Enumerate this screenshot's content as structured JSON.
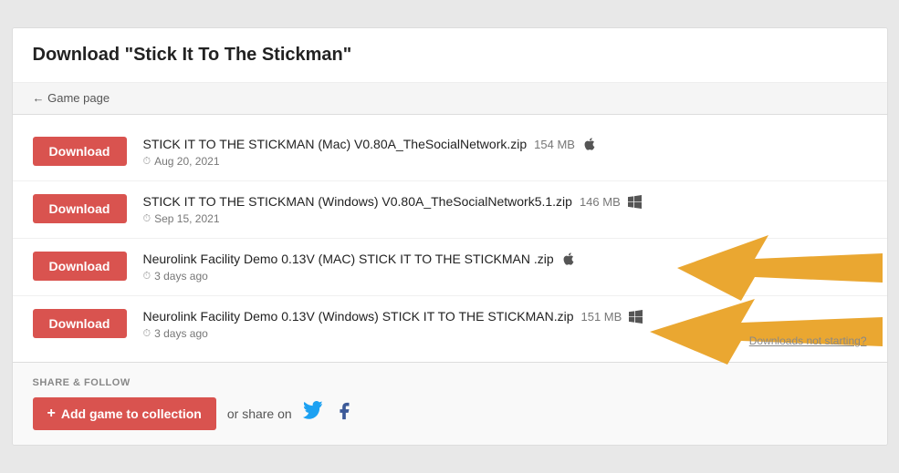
{
  "page": {
    "title_prefix": "Download ",
    "title_quoted": "\"Stick It To The Stickman\"",
    "back_label": "← Game page"
  },
  "downloads": [
    {
      "btn_label": "Download",
      "filename": "STICK IT TO THE STICKMAN (Mac) V0.80A_TheSocialNetwork.zip",
      "size": "154 MB",
      "platform": "mac",
      "date": "Aug 20, 2021"
    },
    {
      "btn_label": "Download",
      "filename": "STICK IT TO THE STICKMAN (Windows) V0.80A_TheSocialNetwork5.1.zip",
      "size": "146 MB",
      "platform": "windows",
      "date": "Sep 15, 2021"
    },
    {
      "btn_label": "Download",
      "filename": "Neurolink Facility Demo 0.13V (MAC) STICK IT TO THE STICKMAN .zip",
      "size": "",
      "platform": "mac",
      "date": "3 days ago"
    },
    {
      "btn_label": "Download",
      "filename": "Neurolink Facility Demo 0.13V (Windows) STICK IT TO THE STICKMAN.zip",
      "size": "151 MB",
      "platform": "windows",
      "date": "3 days ago"
    }
  ],
  "downloads_not_starting": "Downloads not starting?",
  "share": {
    "label": "SHARE & FOLLOW",
    "add_btn": "Add game to collection",
    "or_share": "or share on"
  }
}
